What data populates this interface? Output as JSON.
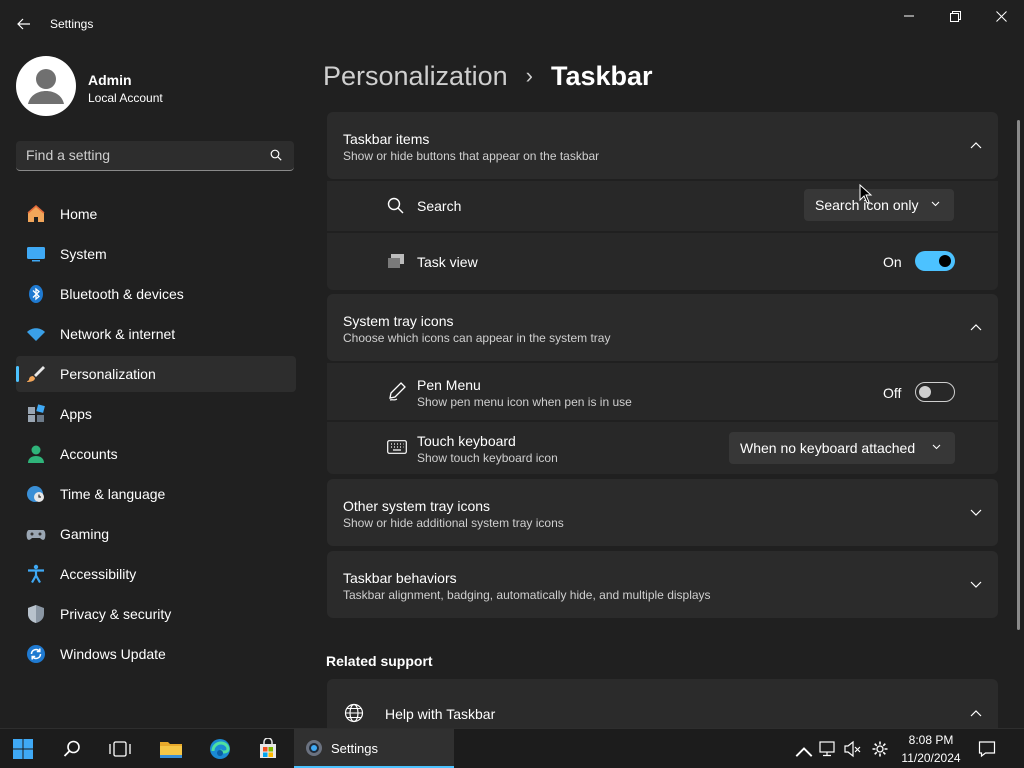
{
  "window": {
    "title": "Settings"
  },
  "profile": {
    "name": "Admin",
    "account_type": "Local Account"
  },
  "search": {
    "placeholder": "Find a setting"
  },
  "nav": {
    "items": [
      {
        "label": "Home",
        "icon": "home-icon"
      },
      {
        "label": "System",
        "icon": "system-icon"
      },
      {
        "label": "Bluetooth & devices",
        "icon": "bluetooth-icon"
      },
      {
        "label": "Network & internet",
        "icon": "wifi-icon"
      },
      {
        "label": "Personalization",
        "icon": "brush-icon",
        "active": true
      },
      {
        "label": "Apps",
        "icon": "apps-icon"
      },
      {
        "label": "Accounts",
        "icon": "accounts-icon"
      },
      {
        "label": "Time & language",
        "icon": "globe-clock-icon"
      },
      {
        "label": "Gaming",
        "icon": "gamepad-icon"
      },
      {
        "label": "Accessibility",
        "icon": "accessibility-icon"
      },
      {
        "label": "Privacy & security",
        "icon": "shield-icon"
      },
      {
        "label": "Windows Update",
        "icon": "update-icon"
      }
    ]
  },
  "breadcrumb": {
    "parent": "Personalization",
    "separator": "›",
    "current": "Taskbar"
  },
  "taskbar_items": {
    "title": "Taskbar items",
    "description": "Show or hide buttons that appear on the taskbar",
    "search": {
      "label": "Search",
      "value": "Search icon only"
    },
    "task_view": {
      "label": "Task view",
      "state_label": "On",
      "on": true
    }
  },
  "system_tray": {
    "title": "System tray icons",
    "description": "Choose which icons can appear in the system tray",
    "pen_menu": {
      "label": "Pen Menu",
      "description": "Show pen menu icon when pen is in use",
      "state_label": "Off",
      "on": false
    },
    "touch_keyboard": {
      "label": "Touch keyboard",
      "description": "Show touch keyboard icon",
      "value": "When no keyboard attached"
    }
  },
  "other_tray": {
    "title": "Other system tray icons",
    "description": "Show or hide additional system tray icons"
  },
  "behaviors": {
    "title": "Taskbar behaviors",
    "description": "Taskbar alignment, badging, automatically hide, and multiple displays"
  },
  "related": {
    "title": "Related support",
    "help_title": "Help with Taskbar"
  },
  "os_taskbar": {
    "settings_label": "Settings",
    "time": "8:08 PM",
    "date": "11/20/2024"
  },
  "colors": {
    "accent": "#4cc2ff",
    "background": "#202020",
    "card": "#2b2b2b"
  }
}
